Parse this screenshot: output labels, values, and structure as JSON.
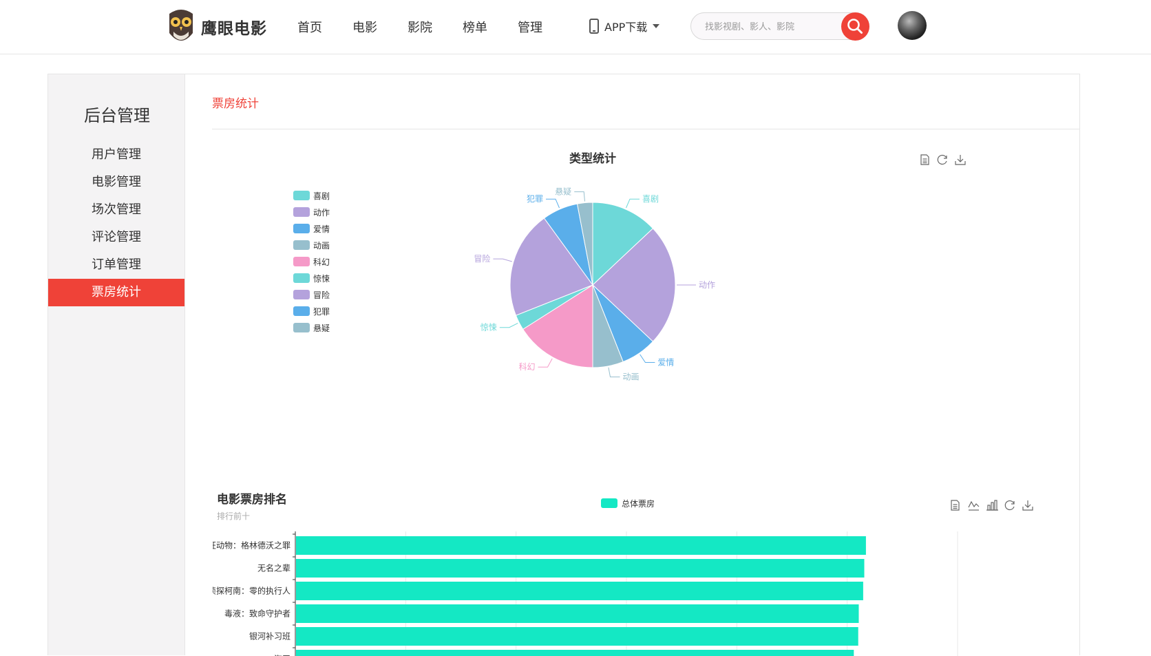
{
  "header": {
    "brand": "鹰眼电影",
    "nav": [
      "首页",
      "电影",
      "影院",
      "榜单",
      "管理"
    ],
    "app_download": "APP下载",
    "search_placeholder": "找影视剧、影人、影院"
  },
  "sidebar": {
    "title": "后台管理",
    "items": [
      "用户管理",
      "电影管理",
      "场次管理",
      "评论管理",
      "订单管理",
      "票房统计"
    ],
    "active_index": 5
  },
  "main": {
    "title": "票房统计"
  },
  "colors": {
    "accent": "#ef4238",
    "bar": "#14e8c4"
  },
  "chart_data": [
    {
      "type": "pie",
      "title": "类型统计",
      "legend_position": "left",
      "toolbox": [
        "data-view-icon",
        "restore-icon",
        "save-image-icon"
      ],
      "slices": [
        {
          "label": "喜剧",
          "value": 13,
          "color": "#6dd8d8"
        },
        {
          "label": "动作",
          "value": 24,
          "color": "#b4a2dc"
        },
        {
          "label": "爱情",
          "value": 7,
          "color": "#5aaeea"
        },
        {
          "label": "动画",
          "value": 6,
          "color": "#97bfcd"
        },
        {
          "label": "科幻",
          "value": 16,
          "color": "#f59ac8"
        },
        {
          "label": "惊悚",
          "value": 3,
          "color": "#6dd8d8"
        },
        {
          "label": "冒险",
          "value": 21,
          "color": "#b4a2dc"
        },
        {
          "label": "犯罪",
          "value": 7,
          "color": "#5aaeea"
        },
        {
          "label": "悬疑",
          "value": 3,
          "color": "#97bfcd"
        }
      ]
    },
    {
      "type": "bar",
      "orientation": "horizontal",
      "title": "电影票房排名",
      "subtitle": "排行前十",
      "legend": [
        "总体票房"
      ],
      "legend_position": "top",
      "toolbox": [
        "data-view-icon",
        "line-switch-icon",
        "bar-switch-icon",
        "restore-icon",
        "save-image-icon"
      ],
      "xlim": [
        0,
        12
      ],
      "grid": true,
      "categories": [
        "疯狂动物：格林德沃之罪",
        "无名之辈",
        "名侦探柯南：零的执行人",
        "毒液：致命守护者",
        "银河补习班",
        "海王"
      ],
      "series": [
        {
          "name": "总体票房",
          "values": [
            10.34,
            10.31,
            10.29,
            10.21,
            10.2,
            10.12
          ]
        }
      ]
    }
  ]
}
